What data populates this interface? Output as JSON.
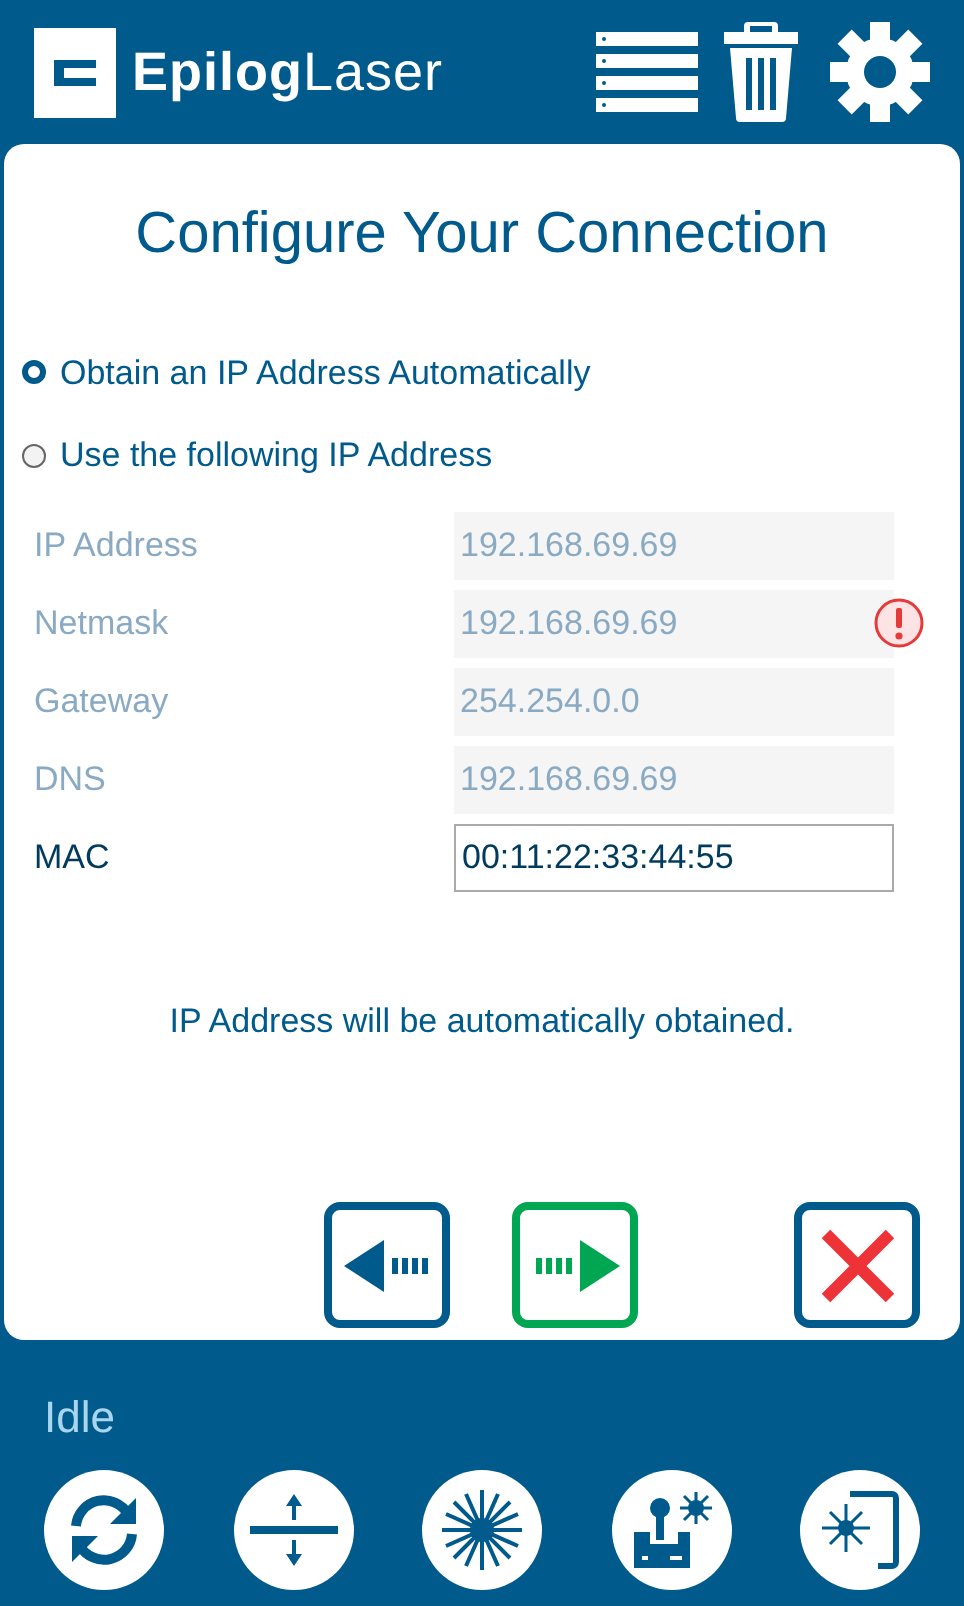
{
  "header": {
    "logo": "**Epilog**Laser"
  },
  "title": "Configure Your Connection",
  "options": [
    {
      "label": "Obtain an IP Address Automatically",
      "selected": true
    },
    {
      "label": "Use the following IP Address",
      "selected": false
    }
  ],
  "fields": [
    {
      "label": "IP Address",
      "value": "192.168.69.69",
      "disabled": true,
      "error": false
    },
    {
      "label": "Netmask",
      "value": "192.168.69.69",
      "disabled": true,
      "error": true
    },
    {
      "label": "Gateway",
      "value": "254.254.0.0",
      "disabled": true,
      "error": false
    },
    {
      "label": "DNS",
      "value": "192.168.69.69",
      "disabled": true,
      "error": false
    },
    {
      "label": "MAC",
      "value": "00:11:22:33:44:55",
      "disabled": false,
      "error": false
    }
  ],
  "message": "IP Address will be automatically obtained.",
  "status": "Idle"
}
